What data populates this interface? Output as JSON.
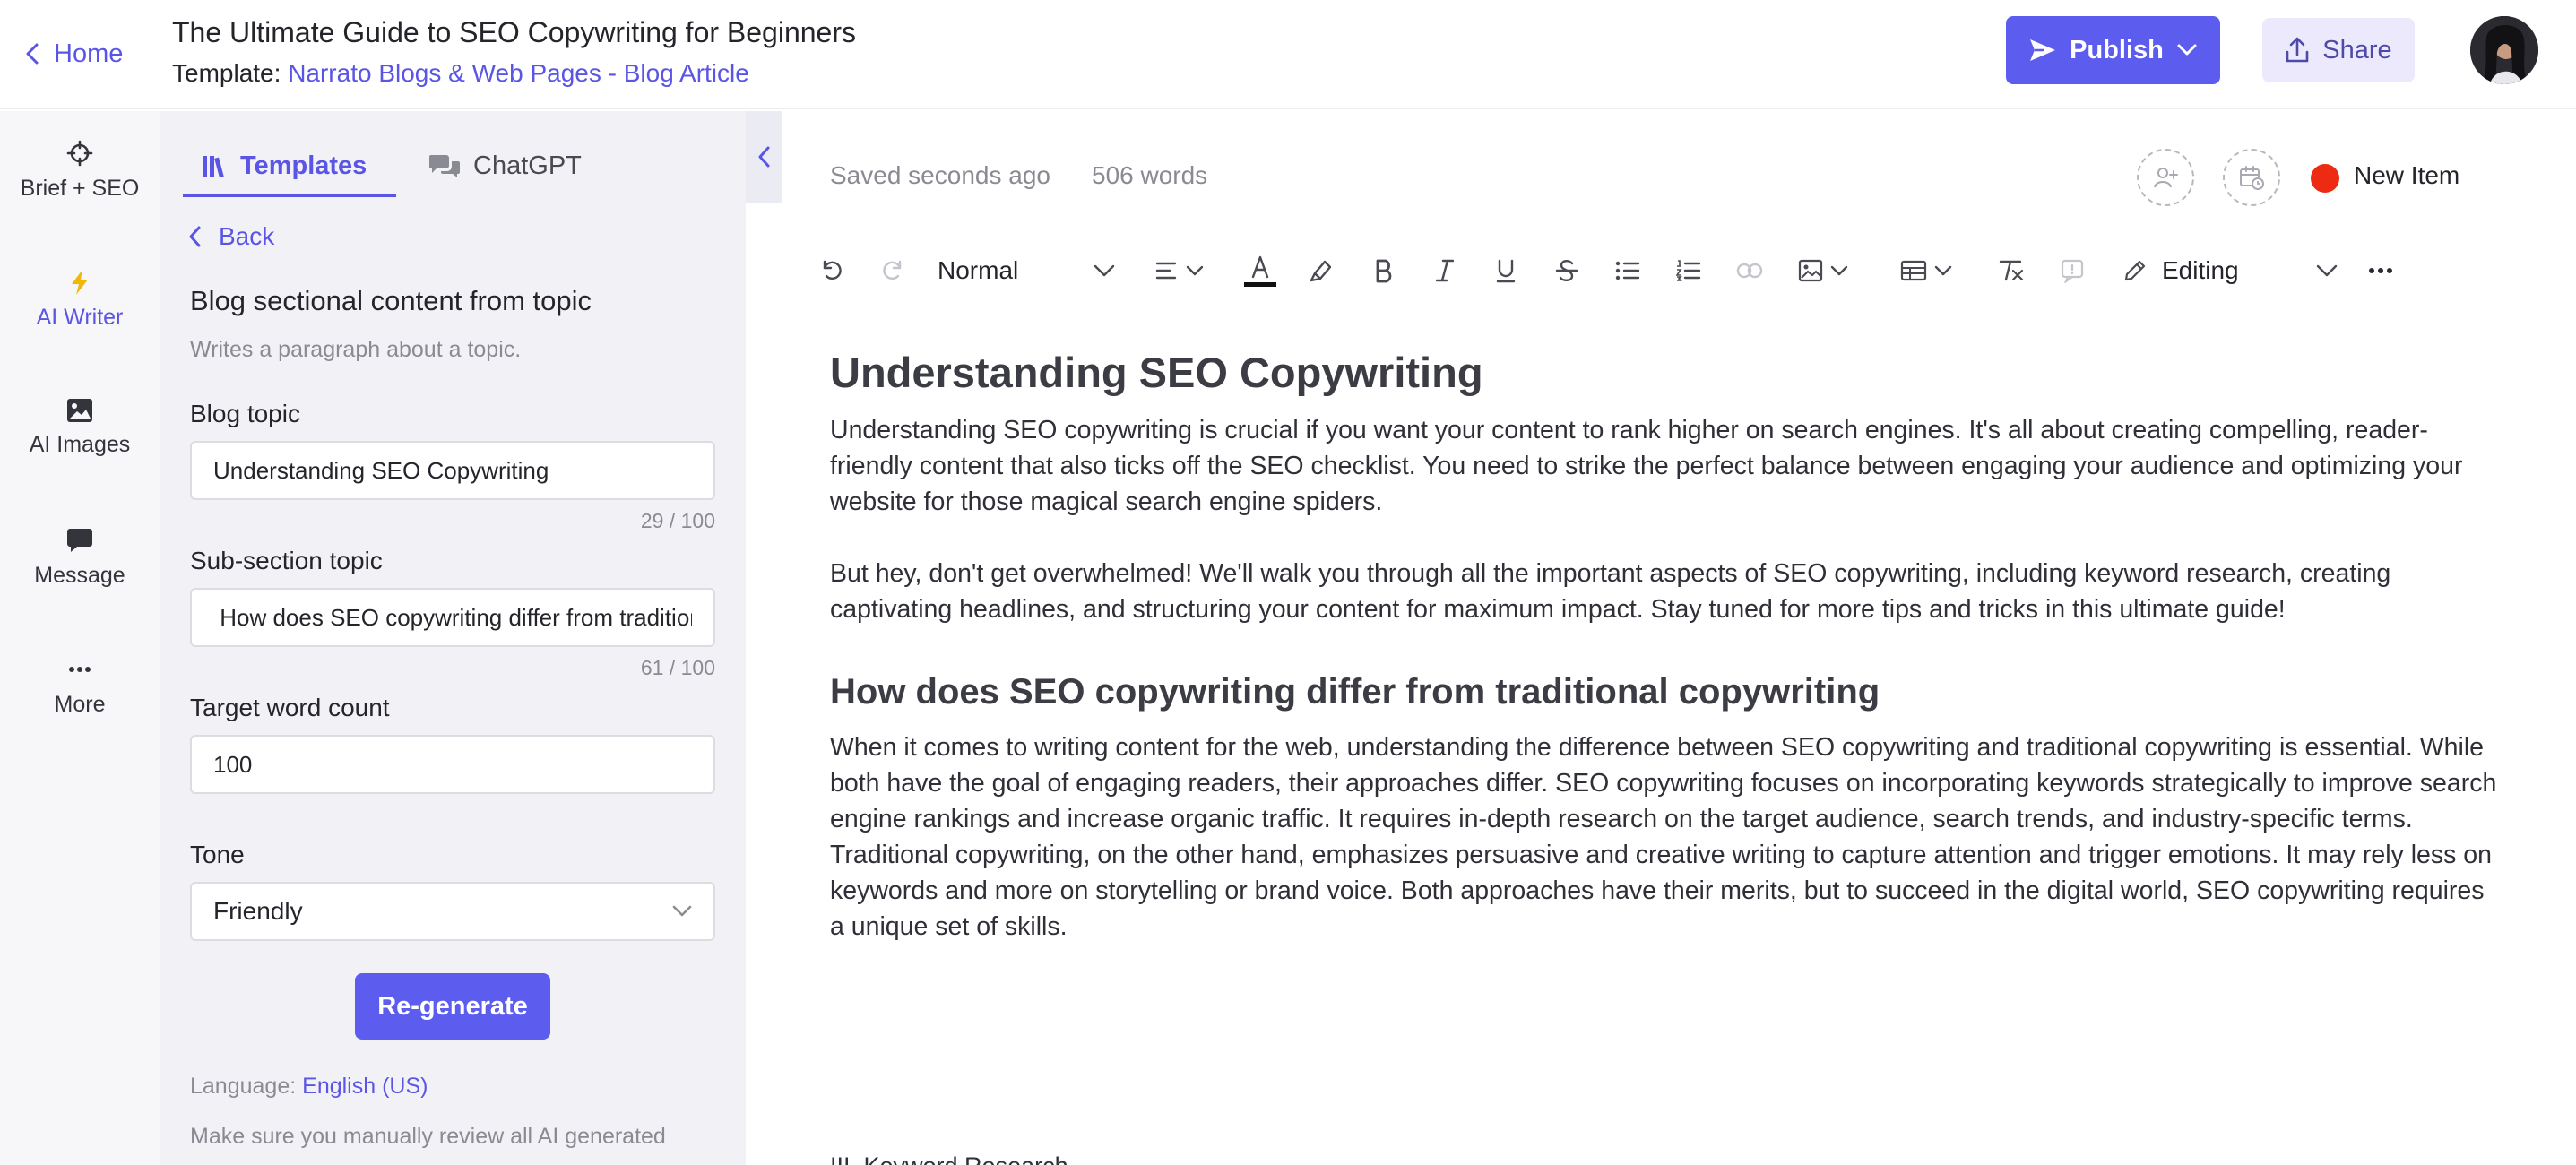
{
  "header": {
    "home_label": "Home",
    "doc_title": "The Ultimate Guide to SEO Copywriting for Beginners",
    "template_prefix": "Template:",
    "template_name": "Narrato Blogs & Web Pages",
    "template_sep": " - ",
    "template_type": "Blog Article",
    "publish_label": "Publish",
    "share_label": "Share"
  },
  "rail": {
    "items": [
      {
        "label": "Brief + SEO",
        "icon": "crosshair-icon"
      },
      {
        "label": "AI Writer",
        "icon": "lightning-icon"
      },
      {
        "label": "AI Images",
        "icon": "image-icon"
      },
      {
        "label": "Message",
        "icon": "chat-icon"
      },
      {
        "label": "More",
        "icon": "more-dots-icon"
      }
    ],
    "active": "AI Writer"
  },
  "panel": {
    "tabs": [
      {
        "label": "Templates",
        "icon": "library-icon"
      },
      {
        "label": "ChatGPT",
        "icon": "chat-bubbles-icon"
      }
    ],
    "back_label": "Back",
    "section_title": "Blog sectional content from topic",
    "section_desc": "Writes a paragraph about a topic.",
    "fields": {
      "blog_topic": {
        "label": "Blog topic",
        "value": "Understanding SEO Copywriting",
        "counter": "29 / 100"
      },
      "sub_section": {
        "label": "Sub-section topic",
        "value": " How does SEO copywriting differ from traditional copywriting",
        "counter": "61 / 100"
      },
      "word_count": {
        "label": "Target word count",
        "value": "100"
      },
      "tone": {
        "label": "Tone",
        "value": "Friendly"
      }
    },
    "regenerate_label": "Re-generate",
    "language_prefix": "Language:",
    "language_value": "English (US)",
    "review_note": "Make sure you manually review all AI generated"
  },
  "editor": {
    "saved_status": "Saved seconds ago",
    "word_count": "506 words",
    "item_status": "New Item",
    "status_color": "#ec2b12",
    "toolbar": {
      "block_style": "Normal",
      "mode": "Editing"
    },
    "content": {
      "h2": "Understanding SEO Copywriting",
      "p1": "Understanding SEO copywriting is crucial if you want your content to rank higher on search engines. It's all about creating compelling, reader-friendly content that also ticks off the SEO checklist. You need to strike the perfect balance between engaging your audience and optimizing your website for those magical search engine spiders.",
      "p2": "But hey, don't get overwhelmed! We'll walk you through all the important aspects of SEO copywriting, including keyword research, creating captivating headlines, and structuring your content for maximum impact. Stay tuned for more tips and tricks in this ultimate guide!",
      "h3": "How does SEO copywriting differ from traditional copywriting",
      "p3": "When it comes to writing content for the web, understanding the difference between SEO copywriting and traditional copywriting is essential. While both have the goal of engaging readers, their approaches differ. SEO copywriting focuses on incorporating keywords strategically to improve search engine rankings and increase organic traffic. It requires in-depth research on the target audience, search trends, and industry-specific terms. Traditional copywriting, on the other hand, emphasizes persuasive and creative writing to capture attention and trigger emotions. It may rely less on keywords and more on storytelling or brand voice. Both approaches have their merits, but to succeed in the digital world, SEO copywriting requires a unique set of skills.",
      "next_line": "III. Keyword Research"
    }
  },
  "colors": {
    "accent": "#5c5cef",
    "link": "#5b55e6",
    "panel_bg": "#f2f2f6"
  }
}
